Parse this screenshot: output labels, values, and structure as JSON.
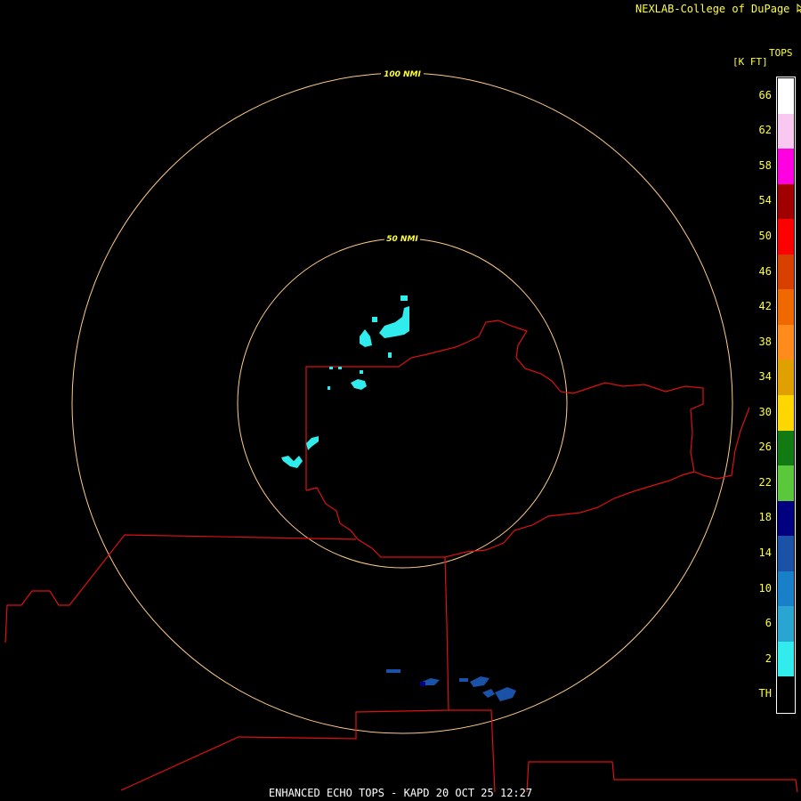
{
  "header": {
    "credit": "NEXLAB-College of DuPage",
    "credit_icon": "cursor-arrow-icon"
  },
  "legend": {
    "title_line1": "TOPS",
    "title_line2": "[K FT]",
    "levels": [
      {
        "label": "66",
        "color": "#ffffff"
      },
      {
        "label": "62",
        "color": "#f8c8f0"
      },
      {
        "label": "58",
        "color": "#ff00e0"
      },
      {
        "label": "54",
        "color": "#a00000"
      },
      {
        "label": "50",
        "color": "#ff0000"
      },
      {
        "label": "46",
        "color": "#d84000"
      },
      {
        "label": "42",
        "color": "#f06800"
      },
      {
        "label": "38",
        "color": "#ff8c1a"
      },
      {
        "label": "34",
        "color": "#e0a000"
      },
      {
        "label": "30",
        "color": "#ffd700"
      },
      {
        "label": "26",
        "color": "#127a12"
      },
      {
        "label": "22",
        "color": "#5ac83a"
      },
      {
        "label": "18",
        "color": "#000080"
      },
      {
        "label": "14",
        "color": "#1a52a8"
      },
      {
        "label": "10",
        "color": "#1880c8"
      },
      {
        "label": "6",
        "color": "#2aa4d0"
      },
      {
        "label": "2",
        "color": "#30ecec"
      },
      {
        "label": "TH",
        "color": "#000000"
      }
    ]
  },
  "range_rings": [
    {
      "label": "100 NMI"
    },
    {
      "label": "50 NMI"
    }
  ],
  "colors": {
    "ring": "#ffcc88",
    "boundary": "#dd1111",
    "echo_low": "#30ecec",
    "echo_mid": "#1a52a8",
    "echo_dark": "#000080"
  },
  "footer": {
    "caption": "ENHANCED ECHO TOPS - KAPD 20 OCT 25 12:27"
  }
}
